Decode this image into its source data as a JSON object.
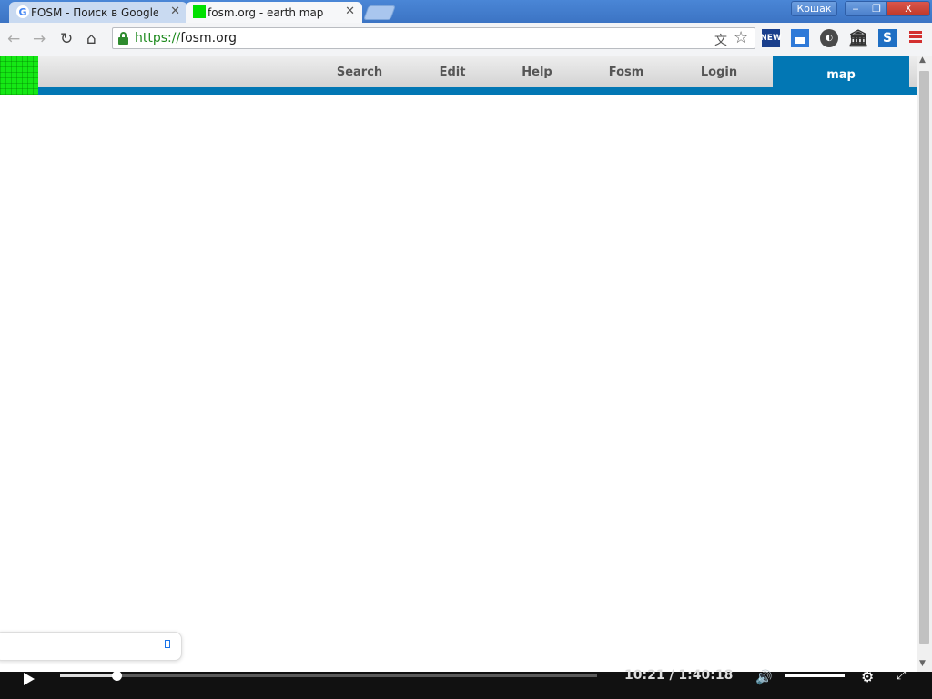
{
  "browser": {
    "tabs": [
      {
        "title": "FOSM - Поиск в Google",
        "favicon": "google-g-icon",
        "active": false
      },
      {
        "title": "fosm.org - earth map",
        "favicon": "fosm-favicon",
        "active": true
      }
    ],
    "profile_name": "Кошак",
    "window_buttons": {
      "minimize": "‒",
      "maximize": "❐",
      "close": "X"
    },
    "url": {
      "scheme": "https://",
      "host": "fosm.org"
    },
    "extensions": [
      "news-icon",
      "picture-icon",
      "disc-icon",
      "museum-icon",
      "s-icon"
    ]
  },
  "site": {
    "nav": [
      "Search",
      "Edit",
      "Help",
      "Fosm",
      "Login"
    ],
    "active_tab": "map"
  },
  "video": {
    "time": "10:21 / 1:40:18",
    "progress": 0.105
  },
  "colors": {
    "nav_blue": "#0277b4",
    "logo_green": "#15e815",
    "url_green": "#1e8a1e"
  }
}
